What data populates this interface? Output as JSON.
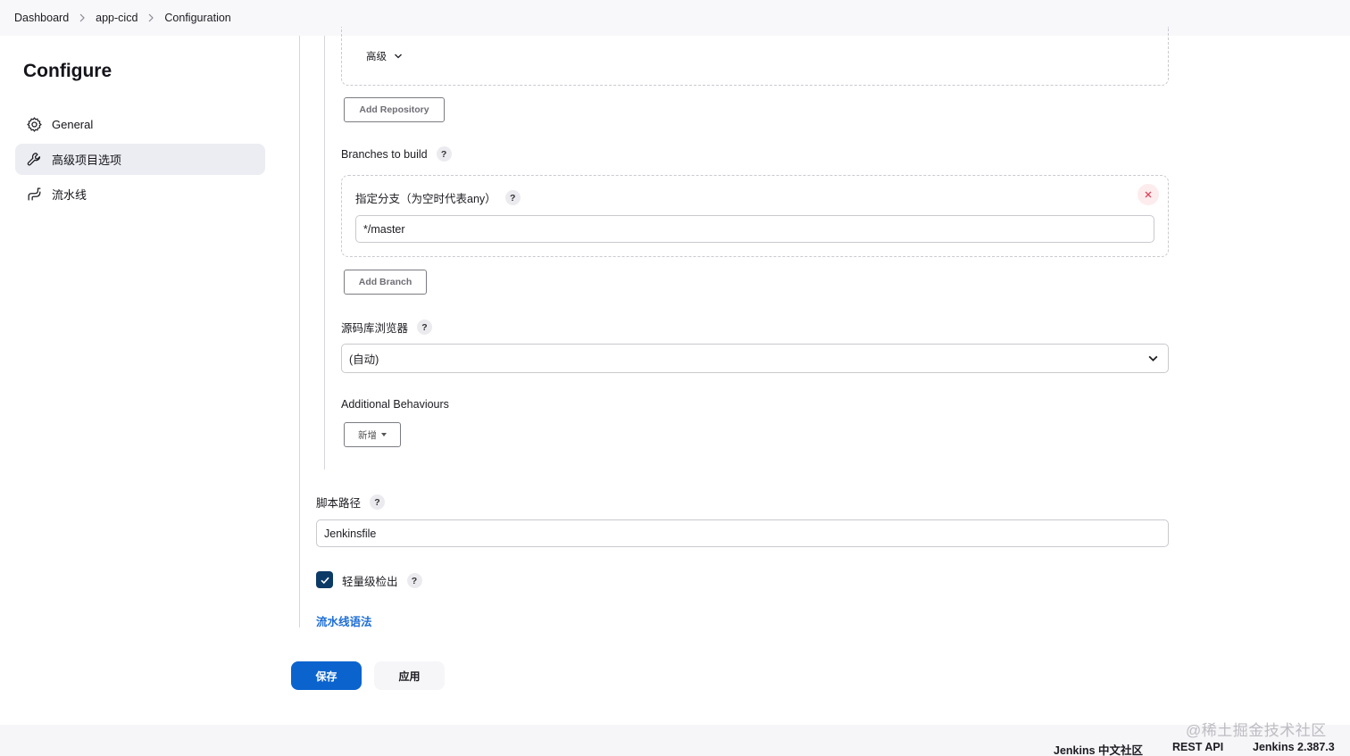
{
  "breadcrumb": {
    "items": [
      {
        "label": "Dashboard"
      },
      {
        "label": "app-cicd"
      },
      {
        "label": "Configuration"
      }
    ]
  },
  "sidebar": {
    "title": "Configure",
    "items": [
      {
        "label": "General",
        "icon": "gear-icon"
      },
      {
        "label": "高级项目选项",
        "icon": "wrench-icon",
        "active": true
      },
      {
        "label": "流水线",
        "icon": "pipeline-icon"
      }
    ]
  },
  "scm": {
    "advanced_label": "高级",
    "add_repository_label": "Add Repository",
    "branches_label": "Branches to build",
    "branch_spec_label": "指定分支（为空时代表any）",
    "branch_spec_value": "*/master",
    "add_branch_label": "Add Branch",
    "browser_label": "源码库浏览器",
    "browser_value": "(自动)",
    "additional_behaviours_label": "Additional Behaviours",
    "add_behaviour_label": "新增"
  },
  "pipeline": {
    "script_path_label": "脚本路径",
    "script_path_value": "Jenkinsfile",
    "lightweight_label": "轻量级检出",
    "lightweight_checked": true,
    "syntax_link": "流水线语法"
  },
  "actions": {
    "save_label": "保存",
    "apply_label": "应用"
  },
  "help_glyph": "?",
  "footer": {
    "community": "Jenkins 中文社区",
    "rest_api": "REST API",
    "version": "Jenkins 2.387.3"
  },
  "watermark": "@稀土掘金技术社区",
  "colors": {
    "primary": "#0b63ce",
    "link": "#1f6fd6",
    "checkbox": "#0b3a66",
    "sidebar_active": "#ececf3",
    "danger": "#e0455a"
  }
}
